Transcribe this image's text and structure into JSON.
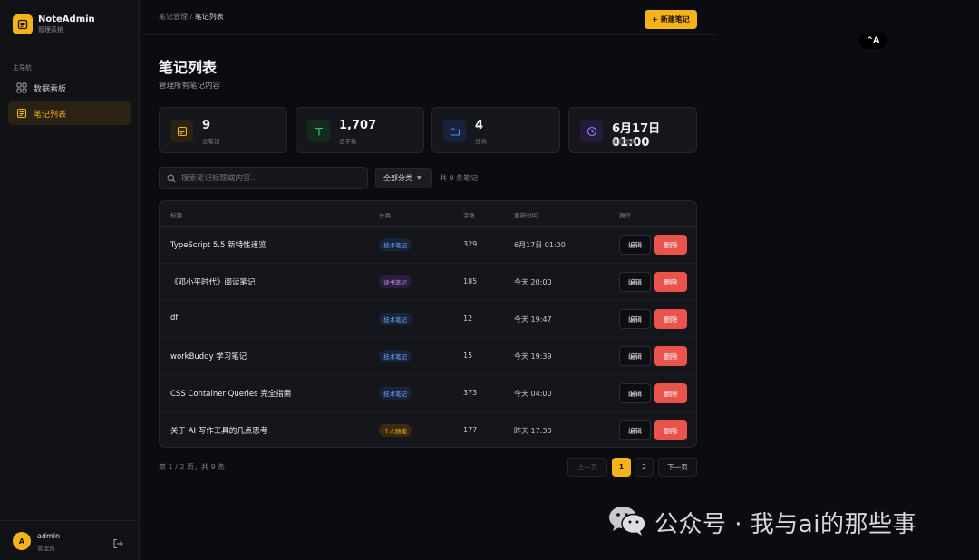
{
  "brand": {
    "name": "NoteAdmin",
    "subtitle": "管理系统"
  },
  "nav": {
    "section_label": "主导航",
    "items": [
      {
        "label": "数据看板",
        "icon": "grid-icon",
        "active": false
      },
      {
        "label": "笔记列表",
        "icon": "note-icon",
        "active": true
      }
    ]
  },
  "user": {
    "avatar_letter": "A",
    "name": "admin",
    "role": "管理员"
  },
  "topbar": {
    "breadcrumb_parent": "笔记管理",
    "breadcrumb_sep": " / ",
    "breadcrumb_current": "笔记列表",
    "new_button": "+ 新建笔记"
  },
  "badge": {
    "label": "^A"
  },
  "page": {
    "title": "笔记列表",
    "subtitle": "管理所有笔记内容"
  },
  "stats": [
    {
      "value": "9",
      "label": "总笔记",
      "icon": "note-icon",
      "color": "#f5b21a"
    },
    {
      "value": "1,707",
      "label": "总字数",
      "icon": "text-icon",
      "color": "#3fbf6f"
    },
    {
      "value": "4",
      "label": "分类",
      "icon": "folder-icon",
      "color": "#4d8ef0"
    },
    {
      "value": "6月17日 01:00",
      "label": "最近更新",
      "icon": "clock-icon",
      "color": "#a27cf0"
    }
  ],
  "search": {
    "placeholder": "搜索笔记标题或内容..."
  },
  "filter": {
    "selected": "全部分类"
  },
  "count_text": "共 9 条笔记",
  "table": {
    "headers": {
      "title": "标题",
      "category": "分类",
      "words": "字数",
      "updated": "更新时间",
      "actions": "操作"
    },
    "edit_label": "编辑",
    "delete_label": "删除",
    "rows": [
      {
        "title": "TypeScript 5.5 新特性速览",
        "category": "技术笔记",
        "kind": "tech",
        "words": "329",
        "updated": "6月17日 01:00"
      },
      {
        "title": "《邓小平时代》阅读笔记",
        "category": "读书笔记",
        "kind": "read",
        "words": "185",
        "updated": "今天 20:00"
      },
      {
        "title": "df",
        "category": "技术笔记",
        "kind": "tech",
        "words": "12",
        "updated": "今天 19:47"
      },
      {
        "title": "workBuddy 学习笔记",
        "category": "技术笔记",
        "kind": "tech",
        "words": "15",
        "updated": "今天 19:39"
      },
      {
        "title": "CSS Container Queries 完全指南",
        "category": "技术笔记",
        "kind": "tech",
        "words": "373",
        "updated": "今天 04:00"
      },
      {
        "title": "关于 AI 写作工具的几点思考",
        "category": "个人随笔",
        "kind": "life",
        "words": "177",
        "updated": "昨天 17:30"
      }
    ]
  },
  "pagination": {
    "info": "第 1 / 2 页，共 9 条",
    "prev": "上一页",
    "pages": [
      "1",
      "2"
    ],
    "current": "1",
    "next": "下一页"
  },
  "watermark": {
    "text": "公众号 · 我与ai的那些事",
    "icon": "wechat-icon"
  }
}
